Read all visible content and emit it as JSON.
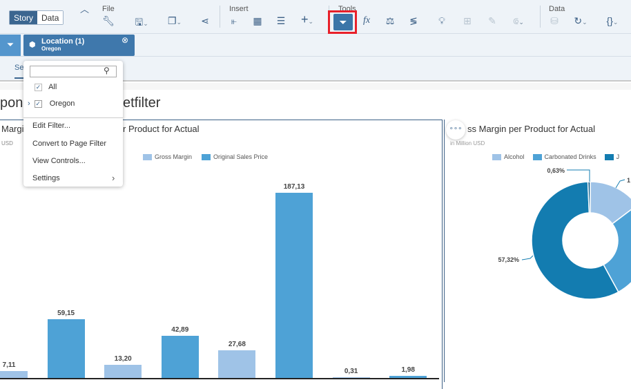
{
  "toolbar": {
    "mode_tabs": [
      "Story",
      "Data"
    ],
    "groups": {
      "file": "File",
      "insert": "Insert",
      "tools": "Tools",
      "data": "Data"
    }
  },
  "filterbar": {
    "chip_title": "Location (1)",
    "chip_value": "Oregon"
  },
  "tabsbar": {
    "tab_fragment": "Se"
  },
  "menu": {
    "search_placeholder": "",
    "items": [
      "All",
      "Oregon"
    ],
    "actions": [
      "Edit Filter...",
      "Convert to Page Filter",
      "View Controls...",
      "Settings"
    ]
  },
  "page": {
    "title_left": "pon",
    "title_right": "etfilter"
  },
  "left_chart": {
    "title_left": "Margi",
    "title_right": "r Product for Actual",
    "unit": "USD"
  },
  "right_chart": {
    "title": "ss Margin per Product for Actual",
    "unit": "in Million USD",
    "more_icon": "ellipsis"
  },
  "highlight_color": "#e8202a",
  "chart_data": [
    {
      "type": "bar",
      "legend": [
        "Gross Margin",
        "Original Sales Price"
      ],
      "colors": [
        "#9fc3e7",
        "#4ea2d6"
      ],
      "bars": [
        {
          "series": "Gross Margin",
          "value": 7.11,
          "label": "7,11"
        },
        {
          "series": "Original Sales Price",
          "value": 59.15,
          "label": "59,15"
        },
        {
          "series": "Gross Margin",
          "value": 13.2,
          "label": "13,20"
        },
        {
          "series": "Original Sales Price",
          "value": 42.89,
          "label": "42,89"
        },
        {
          "series": "Gross Margin",
          "value": 27.68,
          "label": "27,68"
        },
        {
          "series": "Original Sales Price",
          "value": 187.13,
          "label": "187,13"
        },
        {
          "series": "Gross Margin",
          "value": 0.31,
          "label": "0,31"
        },
        {
          "series": "Original Sales Price",
          "value": 1.98,
          "label": "1,98"
        }
      ],
      "legend_placement": "top"
    },
    {
      "type": "pie",
      "donut": true,
      "legend": [
        "Alcohol",
        "Carbonated Drinks",
        "J"
      ],
      "slices": [
        {
          "name": "Alcohol",
          "value": 7.11,
          "color": "#9fc3e7",
          "label": "1"
        },
        {
          "name": "Carbonated Drinks",
          "value": 13.2,
          "color": "#4ea2d6",
          "label": ""
        },
        {
          "name": "J",
          "value": 27.68,
          "color": "#137cb0",
          "label": "57,32%"
        },
        {
          "name": "",
          "value": 0.31,
          "color": "#0b5f8e",
          "label": "0,63%"
        }
      ]
    }
  ]
}
